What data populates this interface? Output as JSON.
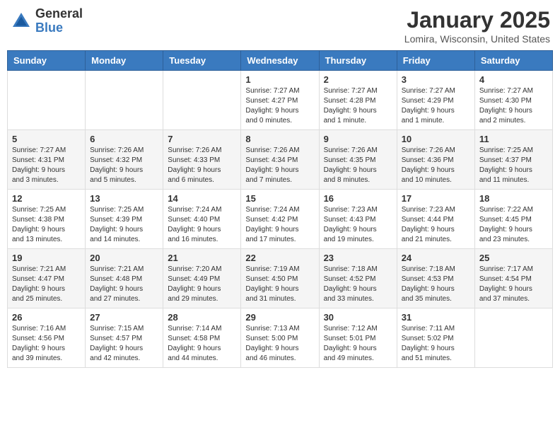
{
  "header": {
    "logo_general": "General",
    "logo_blue": "Blue",
    "month_title": "January 2025",
    "location": "Lomira, Wisconsin, United States"
  },
  "weekdays": [
    "Sunday",
    "Monday",
    "Tuesday",
    "Wednesday",
    "Thursday",
    "Friday",
    "Saturday"
  ],
  "weeks": [
    [
      {
        "day": "",
        "info": ""
      },
      {
        "day": "",
        "info": ""
      },
      {
        "day": "",
        "info": ""
      },
      {
        "day": "1",
        "info": "Sunrise: 7:27 AM\nSunset: 4:27 PM\nDaylight: 9 hours\nand 0 minutes."
      },
      {
        "day": "2",
        "info": "Sunrise: 7:27 AM\nSunset: 4:28 PM\nDaylight: 9 hours\nand 1 minute."
      },
      {
        "day": "3",
        "info": "Sunrise: 7:27 AM\nSunset: 4:29 PM\nDaylight: 9 hours\nand 1 minute."
      },
      {
        "day": "4",
        "info": "Sunrise: 7:27 AM\nSunset: 4:30 PM\nDaylight: 9 hours\nand 2 minutes."
      }
    ],
    [
      {
        "day": "5",
        "info": "Sunrise: 7:27 AM\nSunset: 4:31 PM\nDaylight: 9 hours\nand 3 minutes."
      },
      {
        "day": "6",
        "info": "Sunrise: 7:26 AM\nSunset: 4:32 PM\nDaylight: 9 hours\nand 5 minutes."
      },
      {
        "day": "7",
        "info": "Sunrise: 7:26 AM\nSunset: 4:33 PM\nDaylight: 9 hours\nand 6 minutes."
      },
      {
        "day": "8",
        "info": "Sunrise: 7:26 AM\nSunset: 4:34 PM\nDaylight: 9 hours\nand 7 minutes."
      },
      {
        "day": "9",
        "info": "Sunrise: 7:26 AM\nSunset: 4:35 PM\nDaylight: 9 hours\nand 8 minutes."
      },
      {
        "day": "10",
        "info": "Sunrise: 7:26 AM\nSunset: 4:36 PM\nDaylight: 9 hours\nand 10 minutes."
      },
      {
        "day": "11",
        "info": "Sunrise: 7:25 AM\nSunset: 4:37 PM\nDaylight: 9 hours\nand 11 minutes."
      }
    ],
    [
      {
        "day": "12",
        "info": "Sunrise: 7:25 AM\nSunset: 4:38 PM\nDaylight: 9 hours\nand 13 minutes."
      },
      {
        "day": "13",
        "info": "Sunrise: 7:25 AM\nSunset: 4:39 PM\nDaylight: 9 hours\nand 14 minutes."
      },
      {
        "day": "14",
        "info": "Sunrise: 7:24 AM\nSunset: 4:40 PM\nDaylight: 9 hours\nand 16 minutes."
      },
      {
        "day": "15",
        "info": "Sunrise: 7:24 AM\nSunset: 4:42 PM\nDaylight: 9 hours\nand 17 minutes."
      },
      {
        "day": "16",
        "info": "Sunrise: 7:23 AM\nSunset: 4:43 PM\nDaylight: 9 hours\nand 19 minutes."
      },
      {
        "day": "17",
        "info": "Sunrise: 7:23 AM\nSunset: 4:44 PM\nDaylight: 9 hours\nand 21 minutes."
      },
      {
        "day": "18",
        "info": "Sunrise: 7:22 AM\nSunset: 4:45 PM\nDaylight: 9 hours\nand 23 minutes."
      }
    ],
    [
      {
        "day": "19",
        "info": "Sunrise: 7:21 AM\nSunset: 4:47 PM\nDaylight: 9 hours\nand 25 minutes."
      },
      {
        "day": "20",
        "info": "Sunrise: 7:21 AM\nSunset: 4:48 PM\nDaylight: 9 hours\nand 27 minutes."
      },
      {
        "day": "21",
        "info": "Sunrise: 7:20 AM\nSunset: 4:49 PM\nDaylight: 9 hours\nand 29 minutes."
      },
      {
        "day": "22",
        "info": "Sunrise: 7:19 AM\nSunset: 4:50 PM\nDaylight: 9 hours\nand 31 minutes."
      },
      {
        "day": "23",
        "info": "Sunrise: 7:18 AM\nSunset: 4:52 PM\nDaylight: 9 hours\nand 33 minutes."
      },
      {
        "day": "24",
        "info": "Sunrise: 7:18 AM\nSunset: 4:53 PM\nDaylight: 9 hours\nand 35 minutes."
      },
      {
        "day": "25",
        "info": "Sunrise: 7:17 AM\nSunset: 4:54 PM\nDaylight: 9 hours\nand 37 minutes."
      }
    ],
    [
      {
        "day": "26",
        "info": "Sunrise: 7:16 AM\nSunset: 4:56 PM\nDaylight: 9 hours\nand 39 minutes."
      },
      {
        "day": "27",
        "info": "Sunrise: 7:15 AM\nSunset: 4:57 PM\nDaylight: 9 hours\nand 42 minutes."
      },
      {
        "day": "28",
        "info": "Sunrise: 7:14 AM\nSunset: 4:58 PM\nDaylight: 9 hours\nand 44 minutes."
      },
      {
        "day": "29",
        "info": "Sunrise: 7:13 AM\nSunset: 5:00 PM\nDaylight: 9 hours\nand 46 minutes."
      },
      {
        "day": "30",
        "info": "Sunrise: 7:12 AM\nSunset: 5:01 PM\nDaylight: 9 hours\nand 49 minutes."
      },
      {
        "day": "31",
        "info": "Sunrise: 7:11 AM\nSunset: 5:02 PM\nDaylight: 9 hours\nand 51 minutes."
      },
      {
        "day": "",
        "info": ""
      }
    ]
  ]
}
